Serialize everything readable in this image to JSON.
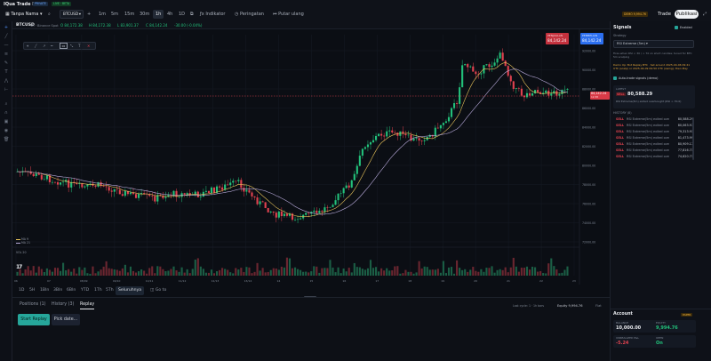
{
  "app": {
    "brand": "IQua Trade Lab",
    "badge_left": "PRIVATE",
    "badge_live": "LIVE · BETA"
  },
  "toolbar": {
    "layout_label": "Tanpa Nama",
    "symbol": "BTCUSD",
    "timeframes": [
      "1m",
      "5m",
      "15m",
      "30m",
      "1h",
      "4h",
      "1D"
    ],
    "active_timeframe": "1h",
    "indicator_label": "Indikator",
    "alert_label": "Peringatan",
    "replay_label": "Putar ulang",
    "account_pill": "DEMO 9,994.76",
    "trade_label": "Trade",
    "publish_label": "Publikasi"
  },
  "legend": {
    "symbol": "BTCUSD",
    "desc": "1h · Binance Spot",
    "o": "O 84,172.38",
    "h": "H 84,172.38",
    "l": "L 83,901.37",
    "c": "C 84,142.24",
    "chg": "-30.00 (-0.04%)"
  },
  "order": {
    "sell_label": "PENJUALAN",
    "sell_price": "84,142.24",
    "buy_label": "PEMBELIAN",
    "buy_price": "84,142.24"
  },
  "price_axis": {
    "ticks": [
      "92000.00",
      "90000.00",
      "88000.00",
      "86000.00",
      "84000.00",
      "82000.00",
      "80000.00",
      "78000.00",
      "76000.00",
      "74000.00",
      "72000.00"
    ],
    "current_tag": "84,142.24",
    "current_sub": "12:38"
  },
  "time_axis": {
    "ticks": [
      "06",
      "07",
      "08/09",
      "09/10",
      "10/11",
      "11/12",
      "12/13",
      "13/14",
      "14",
      "15",
      "16",
      "17",
      "18",
      "19",
      "20",
      "21",
      "22",
      "23"
    ]
  },
  "ma_legend": {
    "fast": "MA 9",
    "slow": "MA 21"
  },
  "volume_label": "VOL 20",
  "periods": {
    "items": [
      "1D",
      "5H",
      "1Bln",
      "3Bln",
      "6Bln",
      "YTD",
      "1Th",
      "5Th",
      "Seluruhnya"
    ],
    "active": "Seluruhnya",
    "goto": "Go to"
  },
  "bottom": {
    "tabs": [
      "Positions (1)",
      "History (3)",
      "Replay"
    ],
    "active_tab": "Replay",
    "start_replay": "Start Replay",
    "pick_date": "Pick date...",
    "meta_label": "Last cycle: 1 · 1h bars",
    "meta_equity": "Equity 9,994.76",
    "meta_flat": "Flat"
  },
  "signals": {
    "title": "Signals",
    "enable_label": "Enabled",
    "strategy_label": "Strategy",
    "strategy_value": "RSI Extreme (5m) ▾",
    "description": "Fires when RSI < 30 / > 70 on short candles; tuned for BTC 5m scalping",
    "warning": "Demo Up: Bot Replay BTC · Set around 2025-04-06 09:41 UTC (scalp) or 2025-04-09 09:50 UTC (swing), then Play",
    "autotrade_label": "Auto-trade signals (demo)",
    "latest_label": "LATEST",
    "latest_type": "SELL",
    "latest_price": "80,588.29",
    "latest_note": "RSI Extreme(5m) exited overbought (RSI > 70.0)",
    "history_label": "HISTORY (8)",
    "history": [
      {
        "type": "SELL",
        "name": "RSI Extreme(5m) exited ove...",
        "price": "80,588.29"
      },
      {
        "type": "SELL",
        "name": "RSI Extreme(5m) exited ove...",
        "price": "80,063.97"
      },
      {
        "type": "SELL",
        "name": "RSI Extreme(5m) exited ove...",
        "price": "79,313.91"
      },
      {
        "type": "SELL",
        "name": "RSI Extreme(5m) exited ove...",
        "price": "81,473.99"
      },
      {
        "type": "SELL",
        "name": "RSI Extreme(5m) exited ove...",
        "price": "80,909.17"
      },
      {
        "type": "SELL",
        "name": "RSI Extreme(5m) exited ove...",
        "price": "77,816.71"
      },
      {
        "type": "SELL",
        "name": "RSI Extreme(5m) exited ove...",
        "price": "74,620.71"
      }
    ]
  },
  "account": {
    "title": "Account",
    "mode": "PAPER",
    "balance_label": "BALANCE",
    "balance": "10,000.00",
    "equity_label": "EQUITY",
    "equity": "9,994.76",
    "upl_label": "UNREALIZED P&L",
    "upl": "-5.24",
    "open_label": "OPEN",
    "open": "On"
  },
  "colors": {
    "up": "#22c07a",
    "down": "#e0424f",
    "ma_fast": "#e7c35a",
    "ma_slow": "#b7a9d9",
    "accent": "#26a69a",
    "background": "#0b0e14"
  }
}
